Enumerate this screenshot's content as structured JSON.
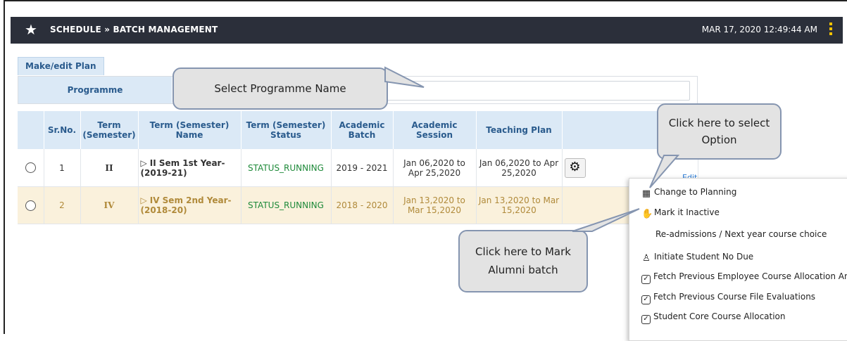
{
  "header": {
    "title": "SCHEDULE » BATCH MANAGEMENT",
    "datetime": "MAR 17, 2020  12:49:44 AM"
  },
  "plan_button": "Make/edit Plan",
  "programme": {
    "label": "Programme",
    "value": ""
  },
  "table": {
    "columns": [
      "",
      "Sr.No.",
      "Term (Semester)",
      "Term (Semester) Name",
      "Term (Semester) Status",
      "Academic Batch",
      "Academic Session",
      "Teaching Plan",
      ""
    ],
    "rows": [
      {
        "sr": "1",
        "term": "II",
        "name": "II Sem 1st Year-(2019-21)",
        "status": "STATUS_RUNNING",
        "batch": "2019 - 2021",
        "session": "Jan 06,2020 to Apr 25,2020",
        "plan": "Jan 06,2020 to Apr 25,2020"
      },
      {
        "sr": "2",
        "term": "IV",
        "name": "IV Sem 2nd Year-(2018-20)",
        "status": "STATUS_RUNNING",
        "batch": "2018 - 2020",
        "session": "Jan 13,2020 to Mar 15,2020",
        "plan": "Jan 13,2020 to Mar 15,2020"
      }
    ]
  },
  "edit_label": "Edit",
  "menu": {
    "items": [
      {
        "label": "Change to Planning",
        "icon": "calendar-icon"
      },
      {
        "label": "Mark it Inactive",
        "icon": "hand-icon"
      },
      {
        "label": "Re-admissions / Next year course choice",
        "icon": ""
      },
      {
        "label": "Initiate Student No Due",
        "icon": "user-icon"
      },
      {
        "label": "Fetch Previous Employee Course Allocation And",
        "icon": "checkbox-icon"
      },
      {
        "label": "Fetch Previous Course File Evaluations",
        "icon": "checkbox-icon"
      },
      {
        "label": "Student Core Course Allocation",
        "icon": "checkbox-icon"
      }
    ]
  },
  "callouts": {
    "programme": "Select Programme Name",
    "option": "Click here to select Option",
    "alumni": "Click here to Mark Alumni batch"
  }
}
